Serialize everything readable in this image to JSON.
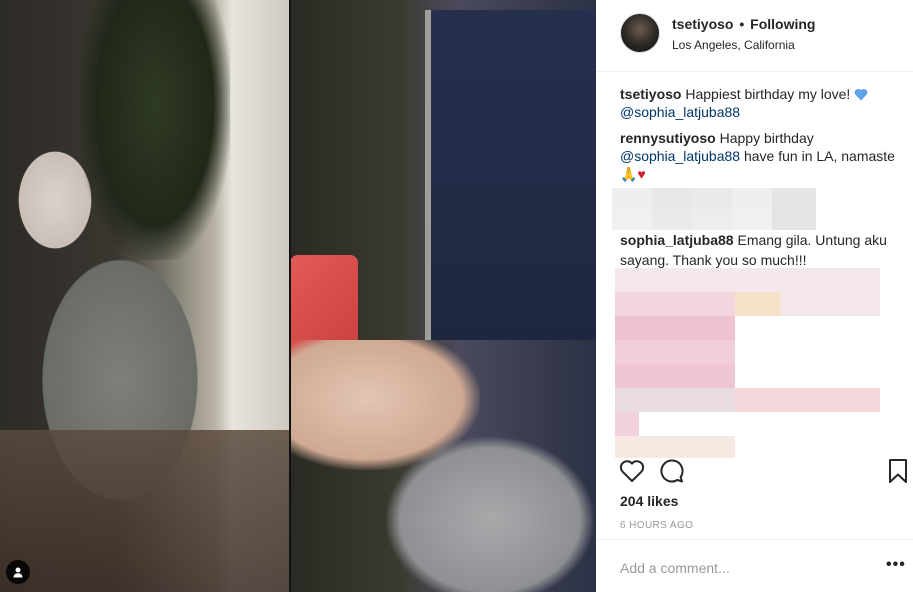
{
  "post": {
    "username": "tsetiyoso",
    "separator": "•",
    "follow_status": "Following",
    "location": "Los Angeles, California"
  },
  "comments": [
    {
      "user": "tsetiyoso",
      "text": "Happiest birthday my love!",
      "emoji": "blue-heart",
      "mention": "@sophia_latjuba88",
      "text_after": ""
    },
    {
      "user": "rennysutiyoso",
      "text": "Happy birthday",
      "mention": "@sophia_latjuba88",
      "text_after": "have fun in LA, namaste",
      "emojis": "🙏♥"
    },
    {
      "user": "sophia_latjuba88",
      "text": "Emang gila. Untung aku sayang. Thank you so much!!!"
    }
  ],
  "icons": {
    "like": "heart-outline-icon",
    "comment": "comment-bubble-icon",
    "save": "bookmark-icon",
    "tag": "person-tag-icon",
    "more": "more-options-icon"
  },
  "stats": {
    "likes": "204 likes",
    "time": "6 HOURS AGO"
  },
  "composer": {
    "placeholder": "Add a comment...",
    "more_label": "•••"
  },
  "colors": {
    "text": "#262626",
    "mention": "#003569",
    "muted": "#999999",
    "divider": "#efefef"
  }
}
